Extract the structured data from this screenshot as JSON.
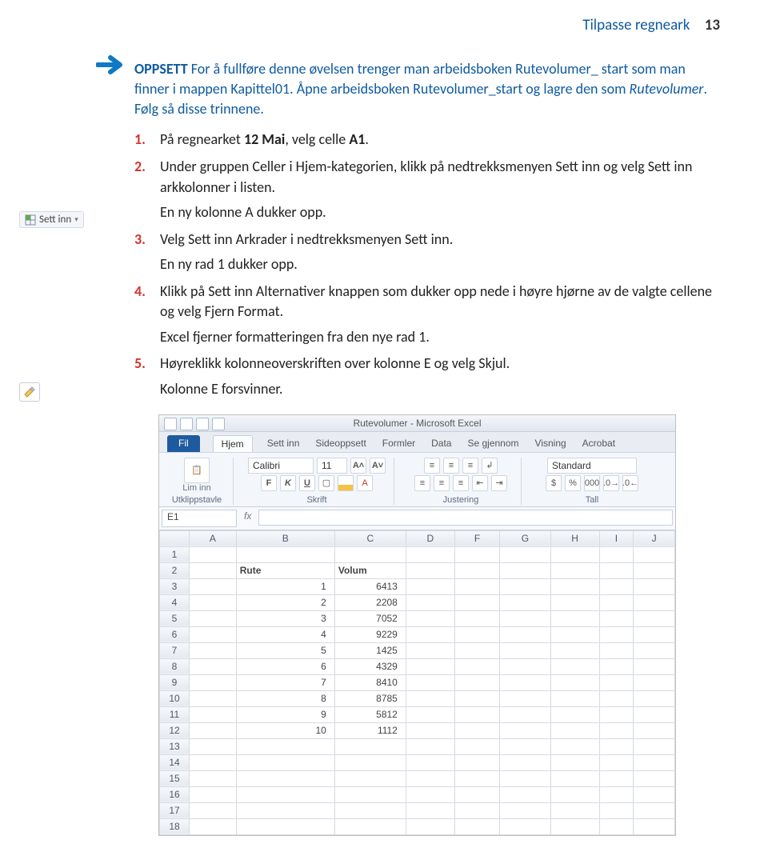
{
  "header": {
    "section_title": "Tilpasse regneark",
    "page_number": "13"
  },
  "oppsett": {
    "label": "OPPSETT",
    "text_a": " For å fullføre denne øvelsen trenger man arbeidsboken Rutevolumer_ start som man finner i mappen Kapittel01. Åpne arbeidsboken Rutevolumer_start og lagre den som ",
    "italic": "Rutevolumer",
    "text_b": ". Følg så disse trinnene."
  },
  "margin": {
    "settinn_icon_label": "Sett inn"
  },
  "steps": [
    {
      "num": "1.",
      "text": "På regnearket ",
      "bold1": "12 Mai",
      "mid1": ", velg celle ",
      "bold2": "A1",
      "end": "."
    },
    {
      "num": "2.",
      "text": "Under gruppen Celler i Hjem-kategorien, klikk på nedtrekksmenyen Sett inn og velg Sett inn arkkolonner i listen.",
      "result": "En ny kolonne A dukker opp."
    },
    {
      "num": "3.",
      "text": "Velg Sett inn Arkrader i nedtrekksmenyen Sett inn.",
      "result": "En ny rad 1 dukker opp."
    },
    {
      "num": "4.",
      "text": "Klikk på Sett inn Alternativer knappen som dukker opp nede i høyre hjørne av de valgte cellene og velg Fjern Format.",
      "result": "Excel fjerner formatteringen fra den nye rad 1."
    },
    {
      "num": "5.",
      "text": "Høyreklikk kolonneoverskriften over kolonne E og velg Skjul.",
      "result": "Kolonne E forsvinner."
    }
  ],
  "excel": {
    "title": "Rutevolumer - Microsoft Excel",
    "tabs": {
      "file": "Fil",
      "home": "Hjem",
      "insert": "Sett inn",
      "pagelayout": "Sideoppsett",
      "formulas": "Formler",
      "data": "Data",
      "review": "Se gjennom",
      "view": "Visning",
      "acrobat": "Acrobat"
    },
    "ribbon": {
      "paste_label": "Lim inn",
      "clipboard_group": "Utklippstavle",
      "font_name": "Calibri",
      "font_size": "11",
      "font_group": "Skrift",
      "align_group": "Justering",
      "number_format": "Standard",
      "number_group": "Tall"
    },
    "formula_bar": {
      "namebox": "E1",
      "fx": "fx"
    },
    "columns": [
      "",
      "A",
      "B",
      "C",
      "D",
      "F",
      "G",
      "H",
      "I",
      "J"
    ],
    "headers": {
      "rute": "Rute",
      "volum": "Volum"
    },
    "rows": [
      {
        "r": "1"
      },
      {
        "r": "2"
      },
      {
        "r": "3",
        "b": "1",
        "c": "6413"
      },
      {
        "r": "4",
        "b": "2",
        "c": "2208"
      },
      {
        "r": "5",
        "b": "3",
        "c": "7052"
      },
      {
        "r": "6",
        "b": "4",
        "c": "9229"
      },
      {
        "r": "7",
        "b": "5",
        "c": "1425"
      },
      {
        "r": "8",
        "b": "6",
        "c": "4329"
      },
      {
        "r": "9",
        "b": "7",
        "c": "8410"
      },
      {
        "r": "10",
        "b": "8",
        "c": "8785"
      },
      {
        "r": "11",
        "b": "9",
        "c": "5812"
      },
      {
        "r": "12",
        "b": "10",
        "c": "1112"
      },
      {
        "r": "13"
      },
      {
        "r": "14"
      },
      {
        "r": "15"
      },
      {
        "r": "16"
      },
      {
        "r": "17"
      },
      {
        "r": "18"
      }
    ]
  }
}
